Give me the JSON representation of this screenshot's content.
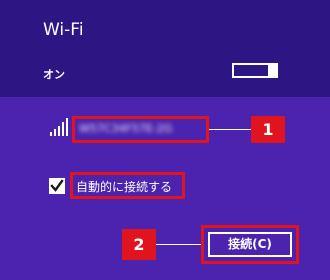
{
  "colors": {
    "header_bg": "#2e1584",
    "body_bg": "#4b23ae",
    "highlight": "#e0141f",
    "text": "#ffffff"
  },
  "header": {
    "title": "Wi-Fi",
    "wifi_state": "オン",
    "toggle_on": true
  },
  "network": {
    "name": "W57C34F57E-2G",
    "signal_icon": "wifi-signal-bars-icon",
    "callout_number": "1"
  },
  "options": {
    "auto_connect_label": "自動的に接続する",
    "auto_connect_checked": true
  },
  "actions": {
    "connect_label": "接続(C)",
    "callout_number": "2"
  }
}
